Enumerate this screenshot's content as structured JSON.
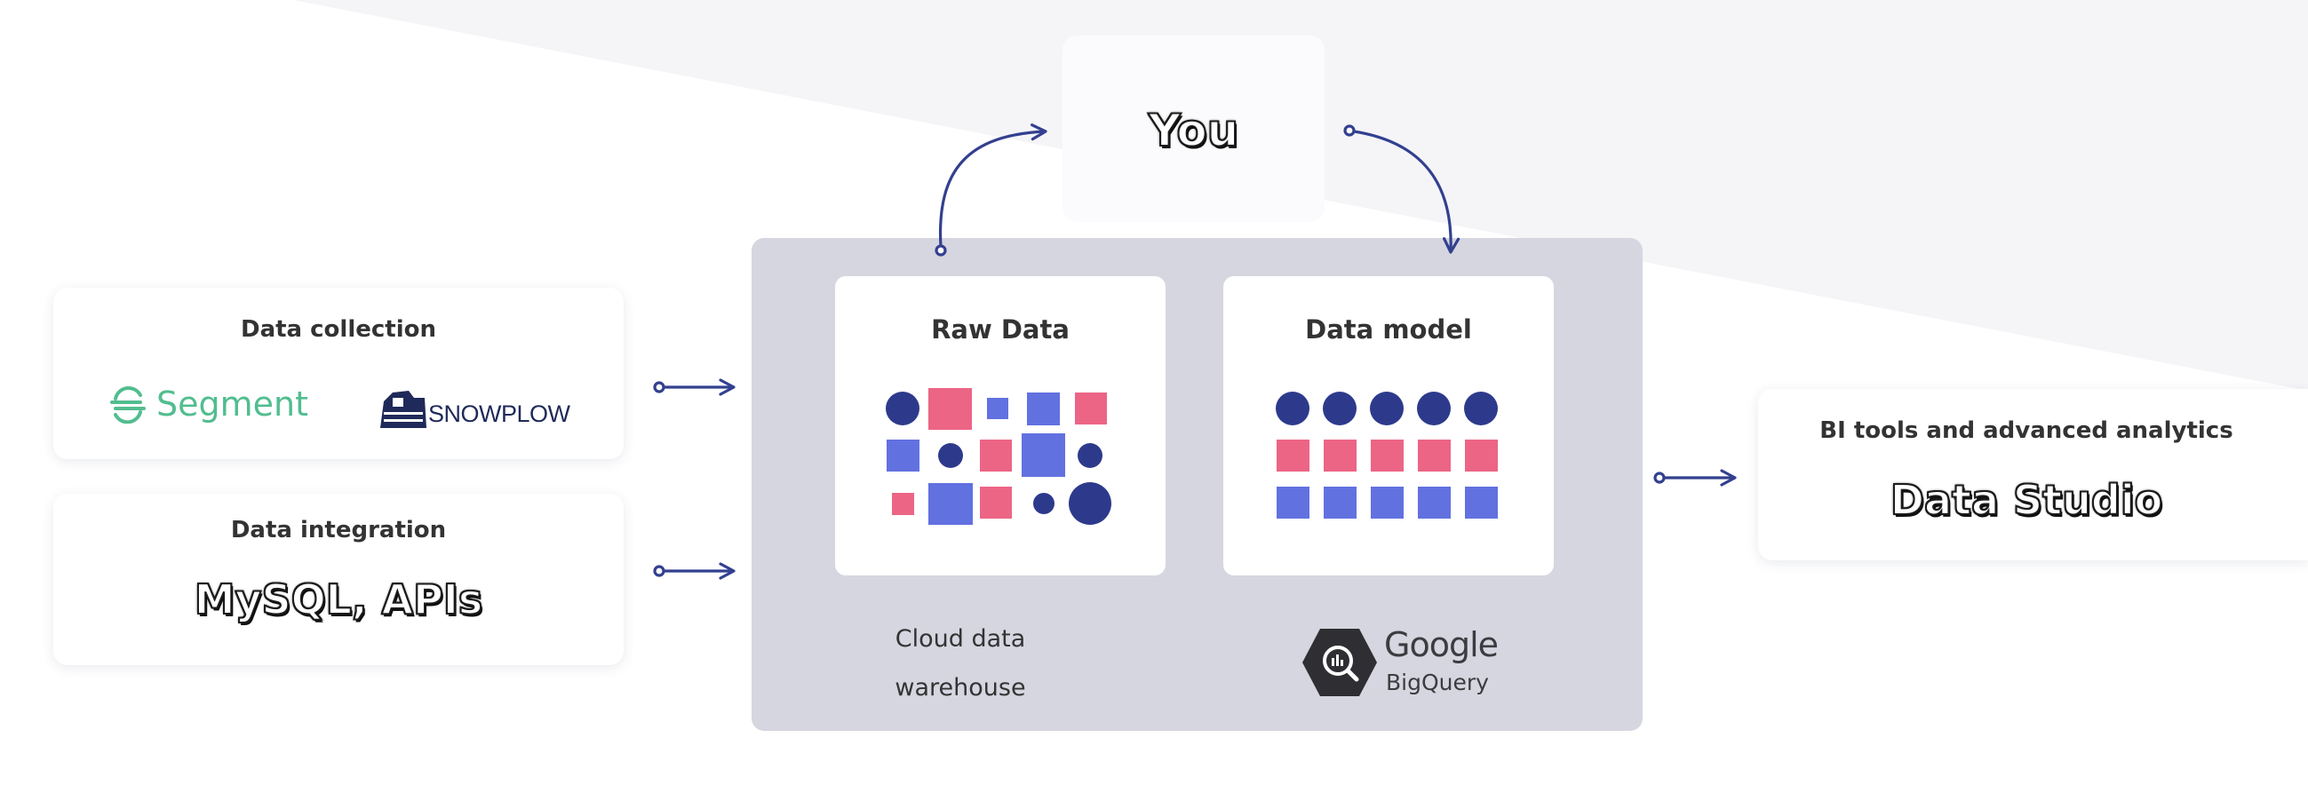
{
  "colors": {
    "navy": "#2d3a8c",
    "blue": "#6271e0",
    "pink": "#ec6585",
    "warehouse_bg": "#d5d6e0",
    "segment_green": "#52bd8f",
    "arrow": "#33408f"
  },
  "you": {
    "label": "You"
  },
  "collection": {
    "title": "Data collection",
    "segment_label": "Segment",
    "snowplow_label": "SNOWPLOW"
  },
  "integration": {
    "title": "Data integration",
    "label": "MySQL, APIs"
  },
  "warehouse": {
    "raw_title": "Raw Data",
    "model_title": "Data model",
    "caption_line1": "Cloud data",
    "caption_line2": "warehouse",
    "bigquery_brand": "Google",
    "bigquery_product": "BigQuery"
  },
  "bi": {
    "title": "BI tools and advanced analytics",
    "label": "Data Studio"
  }
}
